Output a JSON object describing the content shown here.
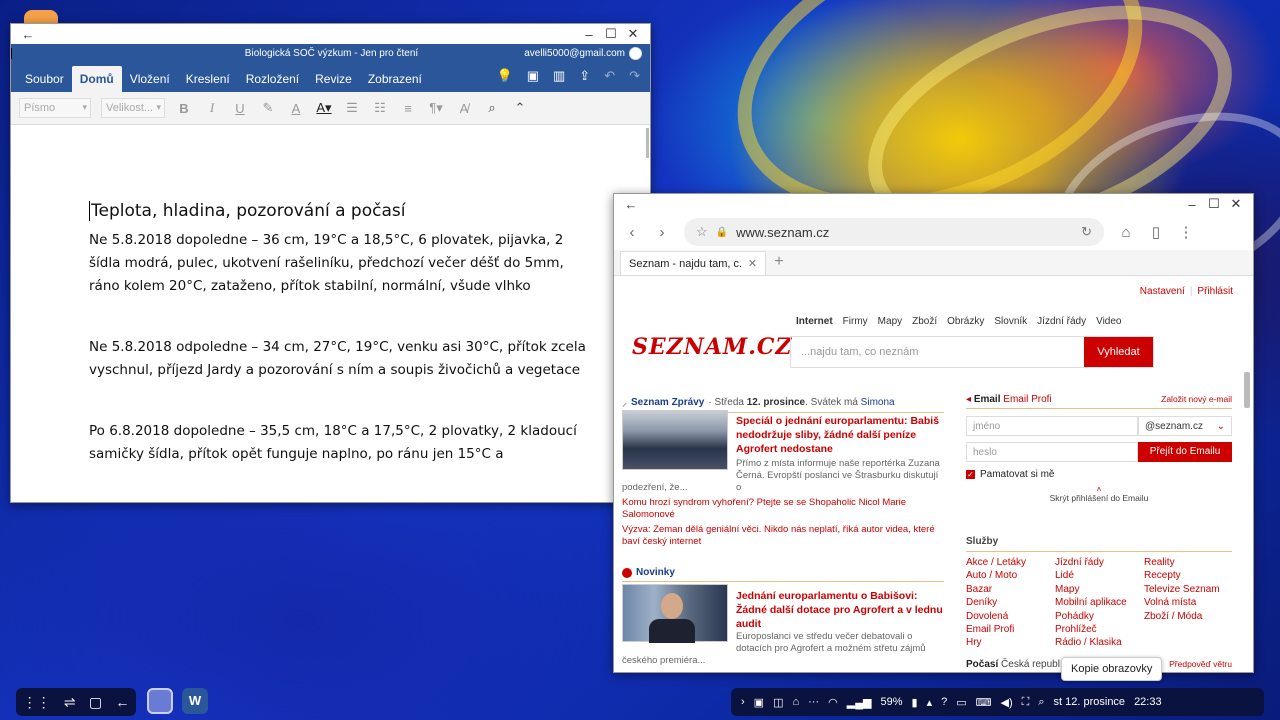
{
  "word": {
    "doc_title": "Biologická SOČ výzkum - Jen pro čtení",
    "account": "avelli5000@gmail.com",
    "tabs": [
      "Soubor",
      "Domů",
      "Vložení",
      "Kreslení",
      "Rozložení",
      "Revize",
      "Zobrazení"
    ],
    "font_placeholder": "Písmo",
    "size_placeholder": "Velikost...",
    "ribbon": {
      "bold": "B",
      "italic": "I",
      "underline": "U"
    },
    "content": {
      "title": "Teplota, hladina, pozorování a počasí",
      "p1": "Ne 5.8.2018 dopoledne – 36 cm, 19°C a 18,5°C, 6 plovatek, pijavka, 2 šídla modrá, pulec, ukotvení rašeliníku, předchozí večer déšť do 5mm, ráno kolem 20°C, zataženo, přítok stabilní, normální, všude vlhko",
      "p2": "Ne 5.8.2018 odpoledne – 34 cm, 27°C, 19°C, venku asi 30°C, přítok zcela vyschnul, příjezd Jardy a pozorování s ním a soupis živočichů a vegetace",
      "p3": "Po 6.8.2018 dopoledne – 35,5 cm, 18°C a 17,5°C, 2 plovatky, 2 kladoucí samičky šídla, přítok opět funguje naplno, po ránu jen 15°C a"
    }
  },
  "browser": {
    "url": "www.seznam.cz",
    "tab_title": "Seznam - najdu tam, c...",
    "page": {
      "top_links": [
        "Nastavení",
        "Přihlásit"
      ],
      "logo": "SEZNAM.CZ",
      "search_tabs": [
        "Internet",
        "Firmy",
        "Mapy",
        "Zboží",
        "Obrázky",
        "Slovník",
        "Jízdní řády",
        "Video"
      ],
      "search_placeholder": "...najdu tam, co neznám",
      "search_button": "Vyhledat",
      "news_source": "Seznam Zprávy",
      "news_date_pre": "Středa ",
      "news_date": "12. prosince",
      "news_svatek": ". Svátek má ",
      "news_name": "Simona",
      "headline1": "Speciál o jednání europarlamentu: Babiš nedodržuje sliby, žádné další peníze Agrofert nedostane",
      "lead1": "Přímo z místa informuje naše reportérka Zuzana Černá. Evropští poslanci ve Štrasburku diskutují o",
      "lead1_cont": "podezření, že...",
      "link1": "Komu hrozí syndrom vyhoření? Ptejte se se Shopaholic Nicol Marie Salomonové",
      "link2": "Výzva: Zeman dělá geniální věci. Nikdo nás neplatí, říká autor videa, které baví český internet",
      "novinky": "Novinky",
      "headline2": "Jednání europarlamentu o Babišovi: Žádné další dotace pro Agrofert a v lednu audit",
      "lead2": "Europoslanci ve středu večer debatovali o dotacích pro Agrofert a možném střetu zájmů",
      "lead2_cont": "českého premiéra...",
      "email_label": "Email",
      "email_profi": "Email Profi",
      "new_email": "Založit nový e-mail",
      "user_placeholder": "jméno",
      "domain": "@seznam.cz",
      "pass_placeholder": "heslo",
      "login_button": "Přejít do Emailu",
      "remember": "Pamatovat si mě",
      "hide_login": "Skrýt přihlášení do Emailu",
      "services_title": "Služby",
      "services": [
        [
          "Akce / Letáky",
          "Auto / Moto",
          "Bazar",
          "Deníky",
          "Dovolená",
          "Email Profi",
          "Hry"
        ],
        [
          "Jízdní řády",
          "Lidé",
          "Mapy",
          "Mobilní aplikace",
          "Pohádky",
          "Prohlížeč",
          "Rádio / Klasika"
        ],
        [
          "Reality",
          "Recepty",
          "Televize Seznam",
          "Volná místa",
          "Zboží / Móda"
        ]
      ],
      "weather_label": "Počasí",
      "weather_place": "Česká republ",
      "forecast": "Předpověď větru"
    }
  },
  "tooltip": "Kopie obrazovky",
  "taskbar": {
    "battery": "59%",
    "date": "st 12. prosince",
    "time": "22:33"
  }
}
